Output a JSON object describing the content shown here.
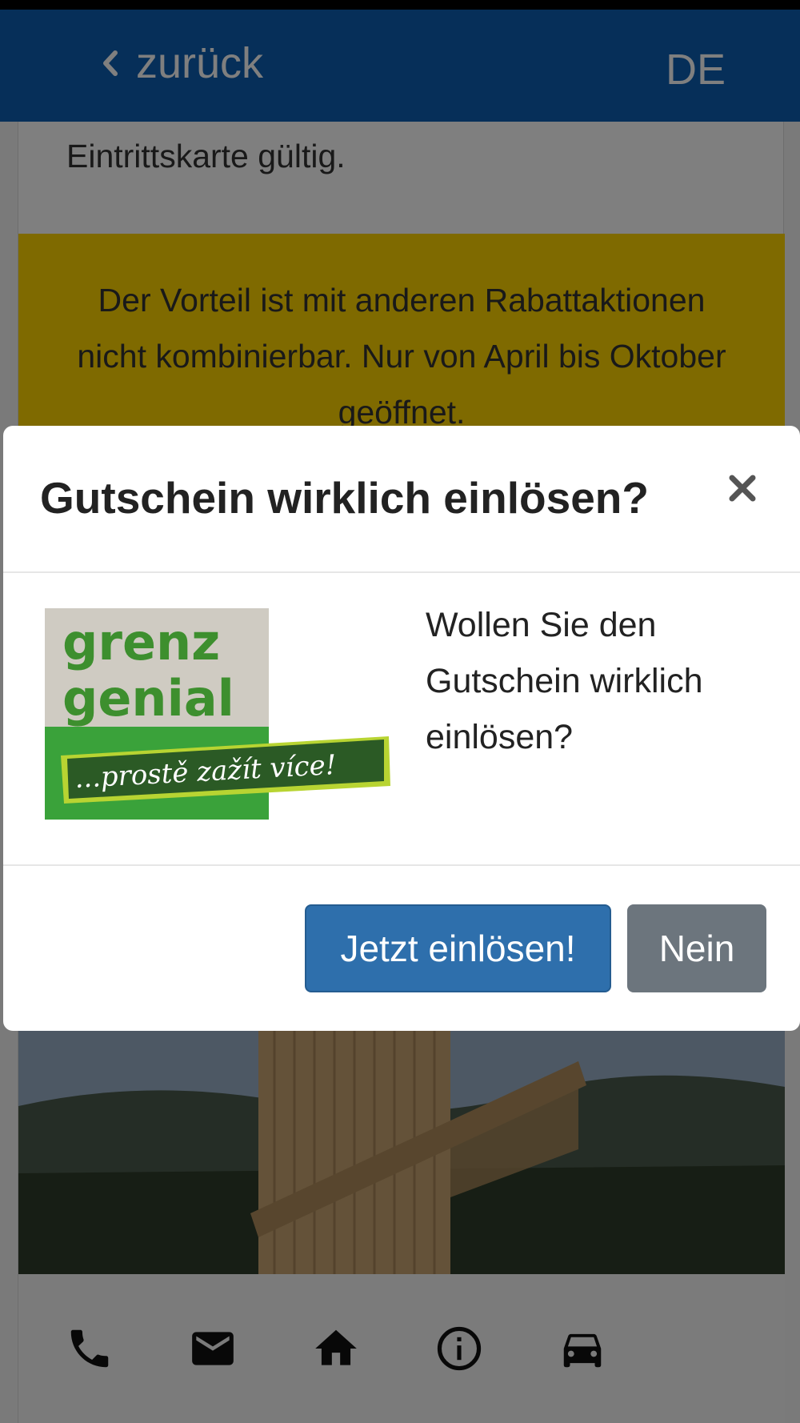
{
  "header": {
    "back_label": "zurück",
    "language": "DE"
  },
  "content": {
    "description_tail": "Eintrittskarte gültig.",
    "notice_text": "Der Vorteil ist mit anderen Rabattaktionen nicht kombinierbar. Nur von April bis Oktober geöffnet.",
    "action_icons": [
      "phone-icon",
      "mail-icon",
      "home-icon",
      "info-icon",
      "car-icon"
    ]
  },
  "modal": {
    "title": "Gutschein wirklich einlösen?",
    "body_text": "Wollen Sie den Gutschein wirklich einlösen?",
    "logo": {
      "line1": "grenz",
      "line2": "genial",
      "slogan": "...prostě zažít více!"
    },
    "confirm_label": "Jetzt einlösen!",
    "cancel_label": "Nein"
  },
  "colors": {
    "nav": "#0d5fb2",
    "notice": "#ffd400",
    "primary_button": "#2e6fac",
    "secondary_button": "#6c757d",
    "logo_green": "#3aa23a"
  }
}
